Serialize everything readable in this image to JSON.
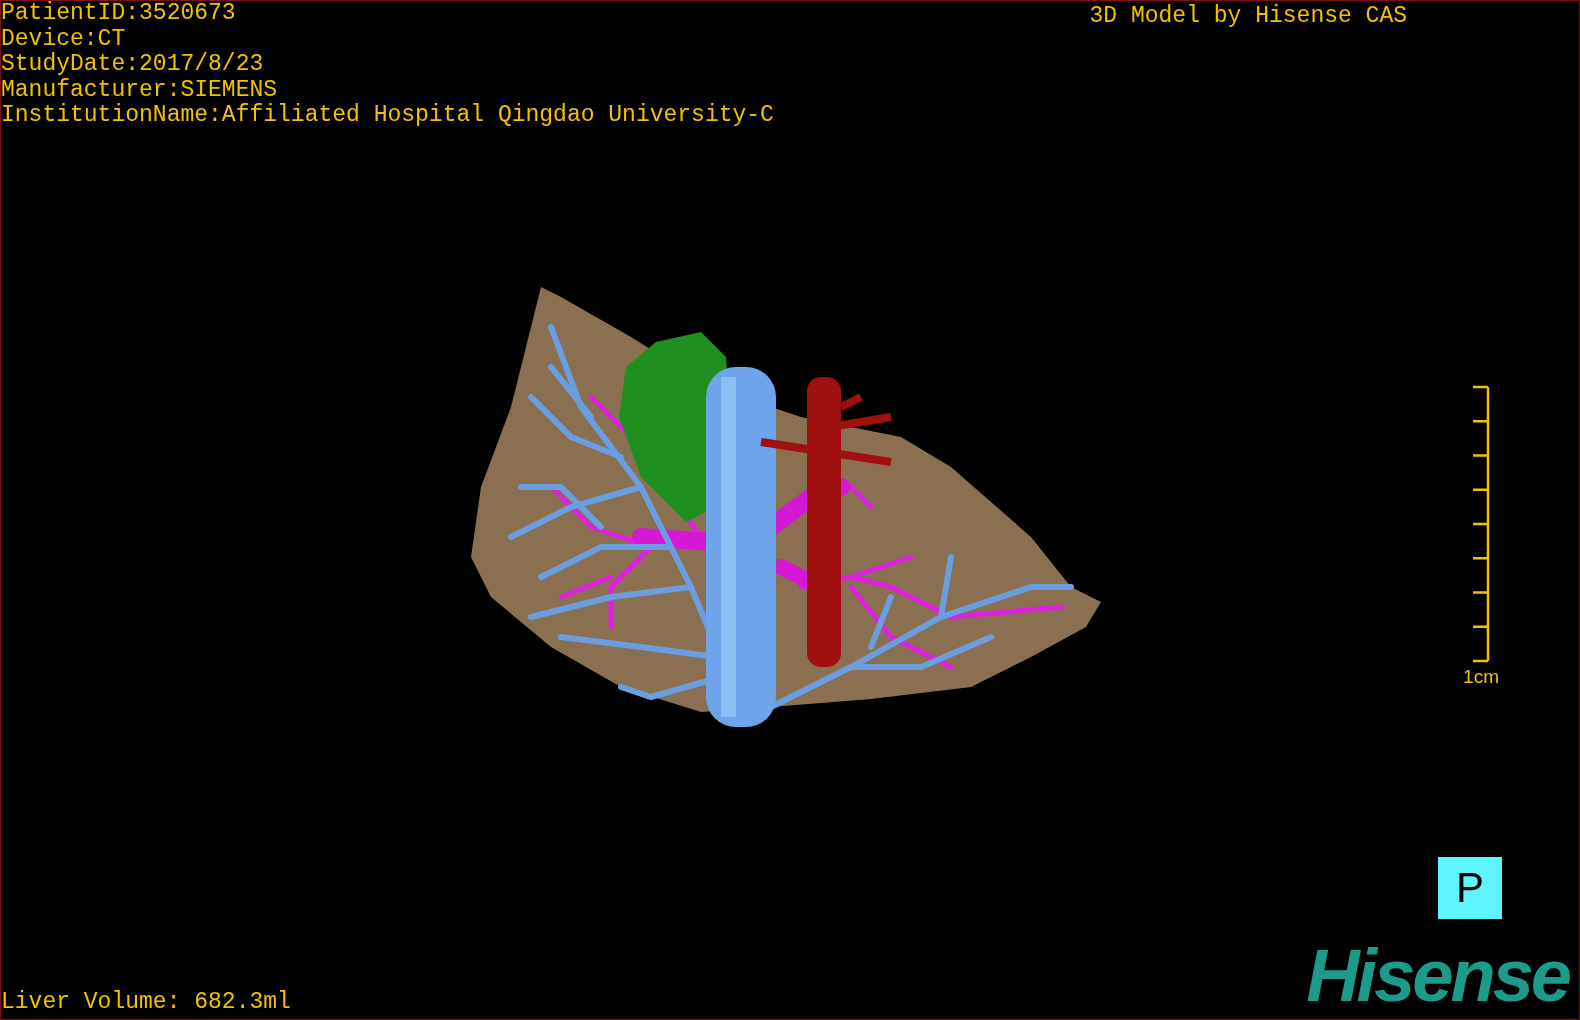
{
  "patient_info": [
    "PatientID:3520673",
    "Device:CT",
    "StudyDate:2017/8/23",
    "Manufacturer:SIEMENS",
    "InstitutionName:Affiliated Hospital Qingdao University-C"
  ],
  "title": "3D Model by Hisense CAS",
  "scale_bar": {
    "label": "1cm"
  },
  "liver_volume": "Liver Volume: 682.3ml",
  "orientation_button": "P",
  "logo": "Hisense"
}
